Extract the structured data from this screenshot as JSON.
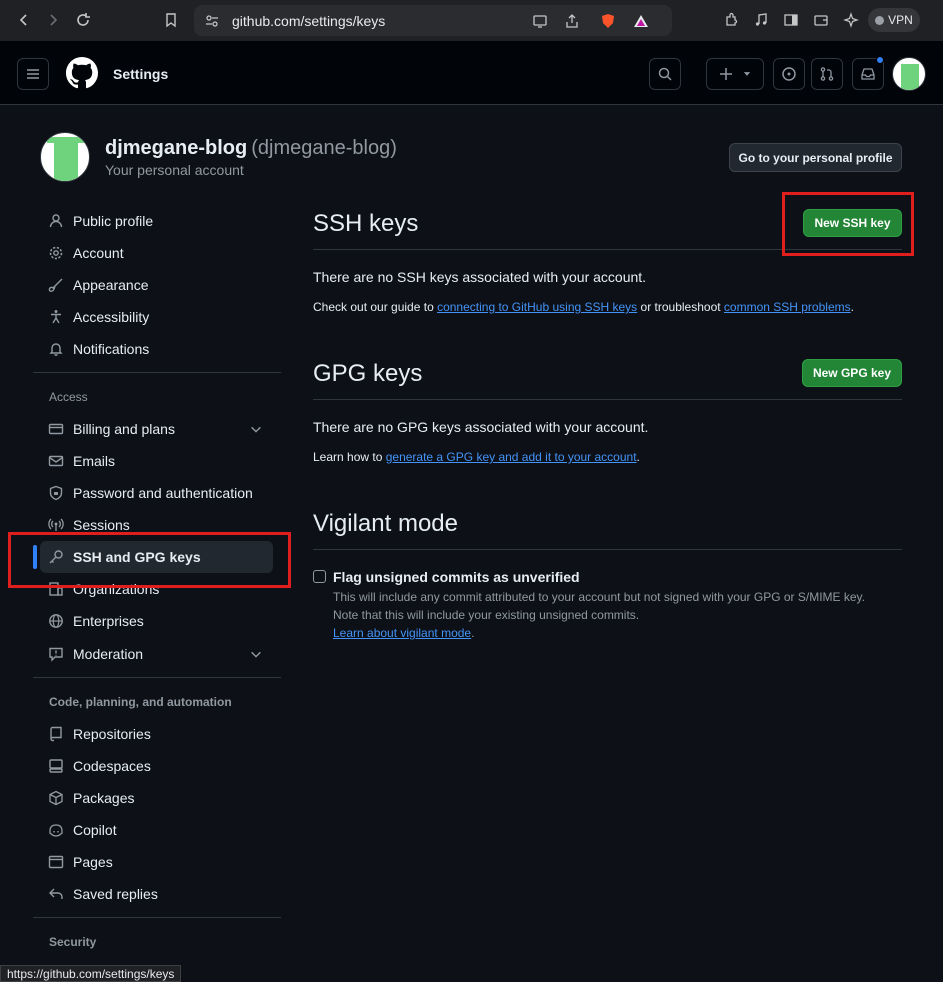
{
  "browser": {
    "url": "github.com/settings/keys",
    "vpn_label": "VPN",
    "status_url": "https://github.com/settings/keys"
  },
  "header": {
    "title": "Settings"
  },
  "profile": {
    "name": "djmegane-blog",
    "handle": "(djmegane-blog)",
    "subtitle": "Your personal account",
    "go_to_profile_label": "Go to your personal profile"
  },
  "sidebar": {
    "items_top": [
      {
        "label": "Public profile",
        "icon": "person-icon"
      },
      {
        "label": "Account",
        "icon": "gear-icon"
      },
      {
        "label": "Appearance",
        "icon": "paintbrush-icon"
      },
      {
        "label": "Accessibility",
        "icon": "accessibility-icon"
      },
      {
        "label": "Notifications",
        "icon": "bell-icon"
      }
    ],
    "access_heading": "Access",
    "items_access": [
      {
        "label": "Billing and plans",
        "icon": "credit-card-icon"
      },
      {
        "label": "Emails",
        "icon": "mail-icon"
      },
      {
        "label": "Password and authentication",
        "icon": "shield-lock-icon"
      },
      {
        "label": "Sessions",
        "icon": "broadcast-icon"
      },
      {
        "label": "SSH and GPG keys",
        "icon": "key-icon"
      },
      {
        "label": "Organizations",
        "icon": "organization-icon"
      },
      {
        "label": "Enterprises",
        "icon": "globe-icon"
      },
      {
        "label": "Moderation",
        "icon": "report-icon"
      }
    ],
    "code_heading": "Code, planning, and automation",
    "items_code": [
      {
        "label": "Repositories",
        "icon": "repo-icon"
      },
      {
        "label": "Codespaces",
        "icon": "codespaces-icon"
      },
      {
        "label": "Packages",
        "icon": "package-icon"
      },
      {
        "label": "Copilot",
        "icon": "copilot-icon"
      },
      {
        "label": "Pages",
        "icon": "browser-icon"
      },
      {
        "label": "Saved replies",
        "icon": "reply-icon"
      }
    ],
    "security_heading": "Security"
  },
  "ssh": {
    "title": "SSH keys",
    "new_button": "New SSH key",
    "empty_text": "There are no SSH keys associated with your account.",
    "guide_prefix": "Check out our guide to ",
    "guide_link": "connecting to GitHub using SSH keys",
    "guide_middle": " or troubleshoot ",
    "problems_link": "common SSH problems",
    "guide_suffix": "."
  },
  "gpg": {
    "title": "GPG keys",
    "new_button": "New GPG key",
    "empty_text": "There are no GPG keys associated with your account.",
    "learn_prefix": "Learn how to ",
    "learn_link": "generate a GPG key and add it to your account",
    "learn_suffix": "."
  },
  "vigilant": {
    "title": "Vigilant mode",
    "checkbox_label": "Flag unsigned commits as unverified",
    "desc_line1": "This will include any commit attributed to your account but not signed with your GPG or S/MIME key.",
    "desc_line2": "Note that this will include your existing unsigned commits.",
    "learn_link": "Learn about vigilant mode",
    "learn_suffix": "."
  },
  "colors": {
    "accent": "#2f81f7",
    "primary_button": "#238636",
    "link": "#4493f8",
    "annotation": "#e01e1e"
  }
}
